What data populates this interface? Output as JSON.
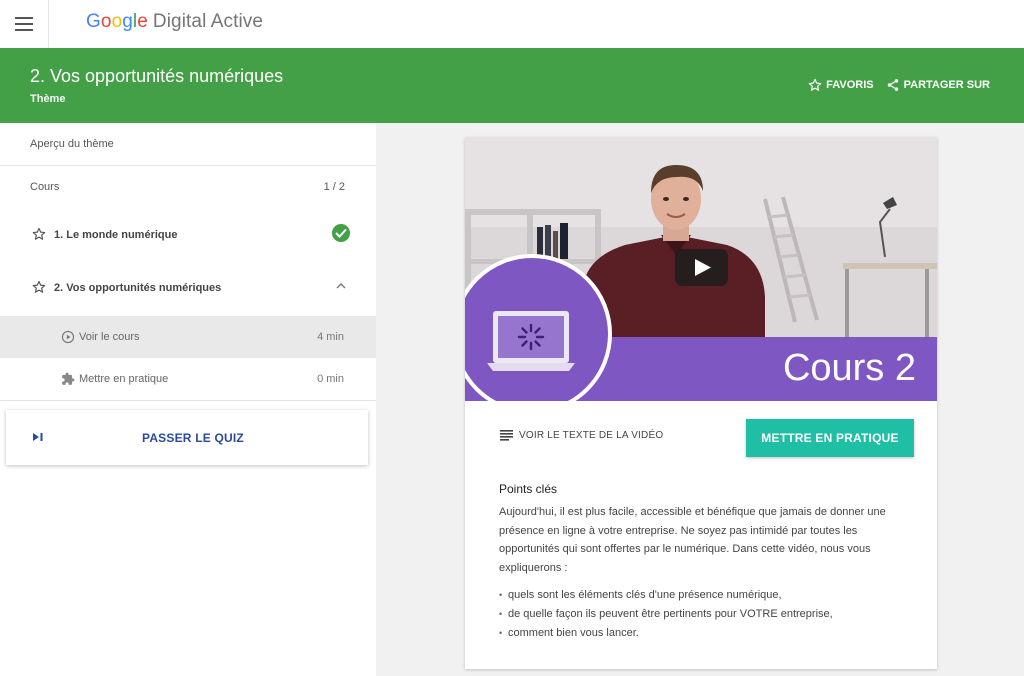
{
  "brand": {
    "google_letters": [
      "G",
      "o",
      "o",
      "g",
      "l",
      "e"
    ],
    "product": "Digital Active"
  },
  "header": {
    "title": "2. Vos opportunités numériques",
    "subtitle": "Thème",
    "favorites_label": "FAVORIS",
    "share_label": "PARTAGER SUR"
  },
  "sidebar": {
    "overview_label": "Aperçu du thème",
    "courses_label": "Cours",
    "courses_count": "1 / 2",
    "lessons": [
      {
        "label": "1. Le monde numérique",
        "completed": true
      },
      {
        "label": "2. Vos opportunités numériques",
        "expanded": true
      }
    ],
    "subitems": [
      {
        "label": "Voir le cours",
        "duration": "4 min",
        "icon": "play-circle-icon",
        "active": true
      },
      {
        "label": "Mettre en pratique",
        "duration": "0 min",
        "icon": "puzzle-icon"
      }
    ],
    "quiz_label": "PASSER LE QUIZ"
  },
  "content": {
    "video_title": "Cours 2",
    "transcript_label": "VOIR LE TEXTE DE LA VIDÉO",
    "practice_button": "METTRE EN PRATIQUE",
    "key_points_title": "Points clés",
    "key_points_text": "Aujourd'hui, il est plus facile, accessible et bénéfique que jamais de donner une présence en ligne à votre entreprise. Ne soyez pas intimidé par toutes les opportunités qui sont offertes par le numérique. Dans cette vidéo, nous vous expliquerons :",
    "key_points": [
      "quels sont les éléments clés d'une présence numérique,",
      "de quelle façon ils peuvent être pertinents pour VOTRE entreprise,",
      "comment bien vous lancer."
    ]
  },
  "colors": {
    "header_green": "#43a047",
    "check_green": "#43a047",
    "button_teal": "#1fbfa6",
    "quiz_blue": "#2b4a9c",
    "video_purple": "#7e57c2"
  }
}
